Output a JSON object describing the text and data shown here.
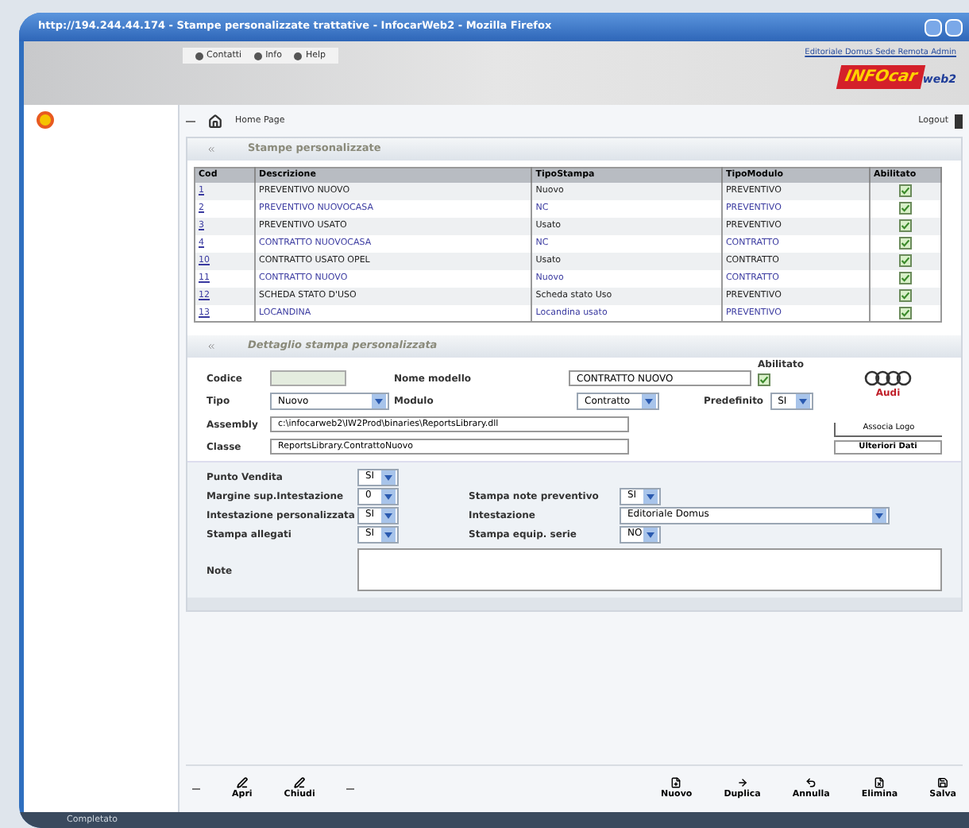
{
  "window": {
    "title": "http://194.244.44.174 - Stampe personalizzate trattative - InfocarWeb2 - Mozilla Firefox"
  },
  "header": {
    "links": [
      "Contatti",
      "Info",
      "Help"
    ],
    "user": "Editoriale Domus Sede Remota Admin",
    "logo": {
      "main": "INFOcar",
      "sub": "web2"
    }
  },
  "nav": {
    "home": "Home Page",
    "logout": "Logout"
  },
  "list_section": {
    "title": "Stampe personalizzate",
    "columns": [
      "Cod",
      "Descrizione",
      "TipoStampa",
      "TipoModulo",
      "Abilitato"
    ],
    "rows": [
      {
        "cod": "1",
        "descrizione": "PREVENTIVO NUOVO",
        "tipo_stampa": "Nuovo",
        "tipo_modulo": "PREVENTIVO",
        "checked": true
      },
      {
        "cod": "2",
        "descrizione": "PREVENTIVO NUOVOCASA",
        "tipo_stampa": "NC",
        "tipo_modulo": "PREVENTIVO",
        "checked": true
      },
      {
        "cod": "3",
        "descrizione": "PREVENTIVO USATO",
        "tipo_stampa": "Usato",
        "tipo_modulo": "PREVENTIVO",
        "checked": true
      },
      {
        "cod": "4",
        "descrizione": "CONTRATTO NUOVOCASA",
        "tipo_stampa": "NC",
        "tipo_modulo": "CONTRATTO",
        "checked": true
      },
      {
        "cod": "10",
        "descrizione": "CONTRATTO USATO OPEL",
        "tipo_stampa": "Usato",
        "tipo_modulo": "CONTRATTO",
        "checked": true
      },
      {
        "cod": "11",
        "descrizione": "CONTRATTO NUOVO",
        "tipo_stampa": "Nuovo",
        "tipo_modulo": "CONTRATTO",
        "checked": true
      },
      {
        "cod": "12",
        "descrizione": "SCHEDA STATO D'USO",
        "tipo_stampa": "Scheda stato Uso",
        "tipo_modulo": "PREVENTIVO",
        "checked": true
      },
      {
        "cod": "13",
        "descrizione": "LOCANDINA",
        "tipo_stampa": "Locandina usato",
        "tipo_modulo": "PREVENTIVO",
        "checked": true
      }
    ]
  },
  "detail_section": {
    "title": "Dettaglio stampa personalizzata",
    "codice": {
      "label": "Codice"
    },
    "nome_modello": {
      "label": "Nome modello",
      "value": "CONTRATTO NUOVO"
    },
    "abilitato": {
      "label": "Abilitato",
      "checked": true
    },
    "tipo": {
      "label": "Tipo",
      "value": "Nuovo"
    },
    "modulo": {
      "label": "Modulo",
      "value": "Contratto"
    },
    "predefinito": {
      "label": "Predefinito",
      "value": "SI"
    },
    "assembly": {
      "label": "Assembly",
      "value": "c:\\infocarweb2\\IW2Prod\\binaries\\ReportsLibrary.dll"
    },
    "classe": {
      "label": "Classe",
      "value": "ReportsLibrary.ContrattoNuovo"
    },
    "brand": "Audi",
    "associa_logo": "Associa Logo",
    "ulteriori_dati": "Ulteriori Dati"
  },
  "options": {
    "left": [
      {
        "label": "Punto Vendita",
        "value": "SI"
      },
      {
        "label": "Margine sup.Intestazione",
        "value": "0"
      },
      {
        "label": "Intestazione personalizzata",
        "value": "SI"
      },
      {
        "label": "Stampa allegati",
        "value": "SI"
      }
    ],
    "right": [
      {
        "label": "Stampa note preventivo",
        "value": "SI"
      },
      {
        "label": "Intestazione",
        "value": "Editoriale Domus"
      },
      {
        "label": "Stampa equip. serie",
        "value": "NO"
      }
    ],
    "note": {
      "label": "Note"
    }
  },
  "toolbar": {
    "left": [
      "Apri",
      "Chiudi"
    ],
    "right": [
      "Nuovo",
      "Duplica",
      "Annulla",
      "Elimina",
      "Salva"
    ]
  },
  "status_bar": {
    "text": "Completato"
  }
}
